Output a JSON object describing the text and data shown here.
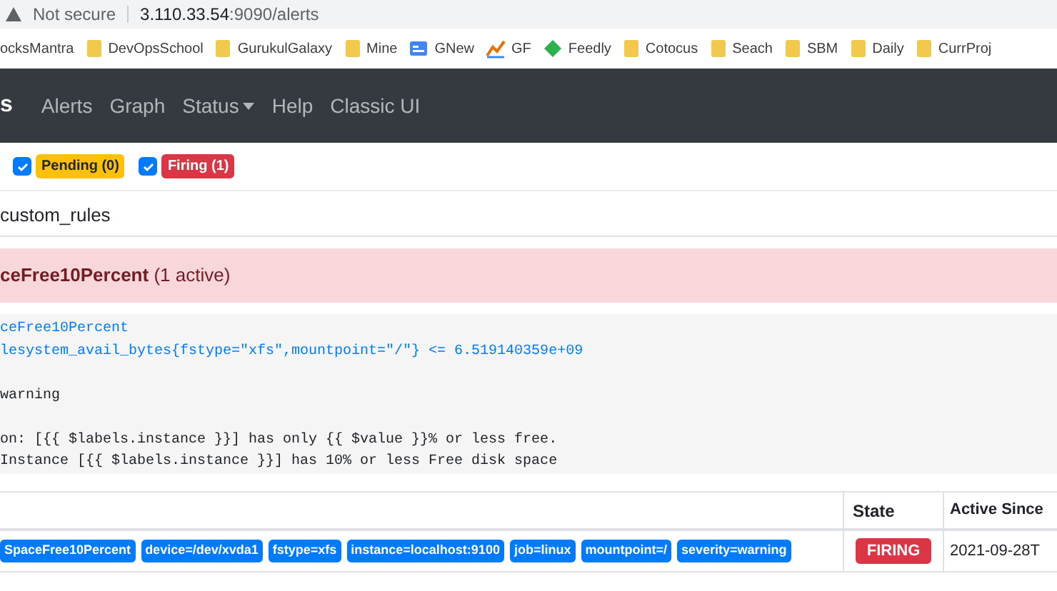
{
  "address_bar": {
    "security": "Not secure",
    "host": "3.110.33.54",
    "path": ":9090/alerts"
  },
  "bookmarks": [
    {
      "label": "ocksMantra",
      "kind": "none"
    },
    {
      "label": "DevOpsSchool",
      "kind": "folder"
    },
    {
      "label": "GurukulGalaxy",
      "kind": "folder"
    },
    {
      "label": "Mine",
      "kind": "folder"
    },
    {
      "label": "GNew",
      "kind": "news"
    },
    {
      "label": "GF",
      "kind": "chart"
    },
    {
      "label": "Feedly",
      "kind": "feedly"
    },
    {
      "label": "Cotocus",
      "kind": "folder"
    },
    {
      "label": "Seach",
      "kind": "folder"
    },
    {
      "label": "SBM",
      "kind": "folder"
    },
    {
      "label": "Daily",
      "kind": "folder"
    },
    {
      "label": "CurrProj",
      "kind": "folder"
    }
  ],
  "navbar": {
    "brand": "s",
    "items": [
      {
        "label": "Alerts",
        "dropdown": false
      },
      {
        "label": "Graph",
        "dropdown": false
      },
      {
        "label": "Status",
        "dropdown": true
      },
      {
        "label": "Help",
        "dropdown": false
      },
      {
        "label": "Classic UI",
        "dropdown": false
      }
    ]
  },
  "filters": [
    {
      "label": "Pending (0)",
      "kind": "pending",
      "checked": true
    },
    {
      "label": "Firing (1)",
      "kind": "firing",
      "checked": true
    }
  ],
  "group": {
    "name": "custom_rules"
  },
  "alert": {
    "name": "ceFree10Percent",
    "count": "(1 active)",
    "rule_lines": [
      {
        "text": "ceFree10Percent",
        "kind": "link"
      },
      {
        "text": "lesystem_avail_bytes{fstype=\"xfs\",mountpoint=\"/\"} <= 6.519140359e+09",
        "kind": "link"
      },
      {
        "kind": "blank"
      },
      {
        "text": "warning",
        "kind": "plain"
      },
      {
        "kind": "blank"
      },
      {
        "text": "on: [{{ $labels.instance }}] has only {{ $value }}% or less free.",
        "kind": "plain"
      },
      {
        "text": "Instance [{{ $labels.instance }}] has 10% or less Free disk space",
        "kind": "plain"
      }
    ]
  },
  "table": {
    "columns": [
      "State",
      "Active Since"
    ],
    "rows": [
      {
        "labels": [
          "SpaceFree10Percent",
          "device=/dev/xvda1",
          "fstype=xfs",
          "instance=localhost:9100",
          "job=linux",
          "mountpoint=/",
          "severity=warning"
        ],
        "state": "FIRING",
        "active_since": "2021-09-28T"
      }
    ]
  }
}
